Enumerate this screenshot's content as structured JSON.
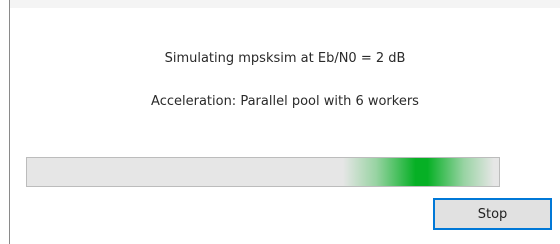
{
  "messages": {
    "status": "Simulating mpsksim at Eb/N0 = 2 dB",
    "acceleration": "Acceleration: Parallel pool with 6 workers"
  },
  "progress": {
    "mode": "indeterminate",
    "glow_start_fraction": 0.67,
    "glow_width_fraction": 0.32,
    "color": "#06b025"
  },
  "buttons": {
    "stop_label": "Stop"
  },
  "colors": {
    "button_focus_border": "#0078d7"
  }
}
